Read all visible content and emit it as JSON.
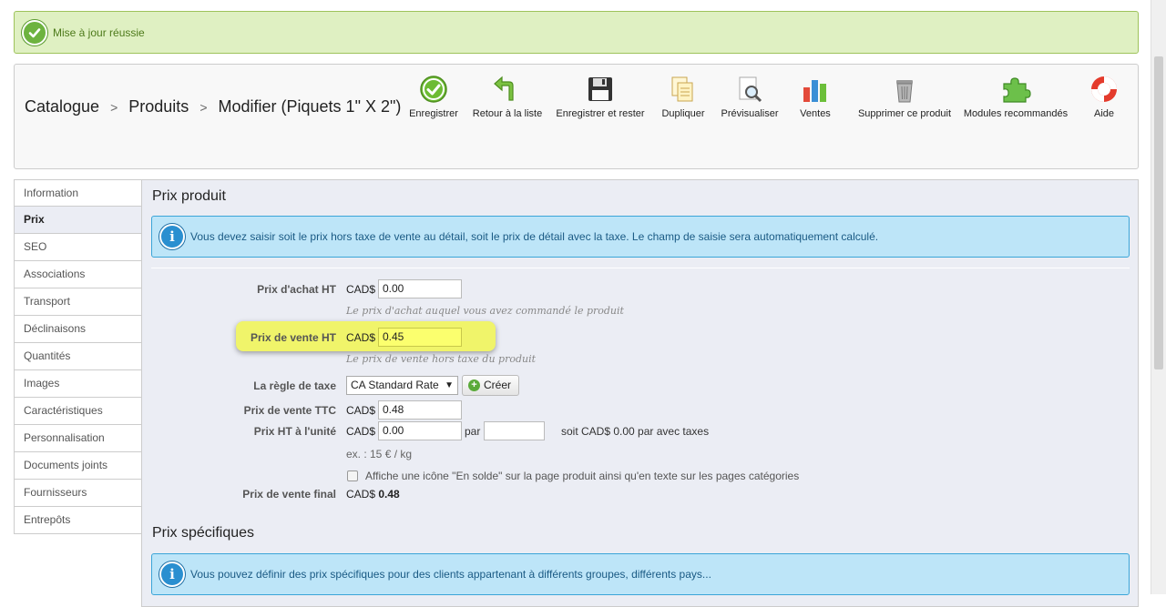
{
  "alert": {
    "message": "Mise à jour réussie"
  },
  "breadcrumb": {
    "items": [
      "Catalogue",
      "Produits",
      "Modifier (Piquets 1\" X 2\")"
    ],
    "separator": ">"
  },
  "toolbar": {
    "save": "Enregistrer",
    "back": "Retour à la liste",
    "save_stay": "Enregistrer et rester",
    "duplicate": "Dupliquer",
    "preview": "Prévisualiser",
    "sales": "Ventes",
    "delete": "Supprimer ce produit",
    "modules": "Modules recommandés",
    "help": "Aide"
  },
  "sidebar": {
    "items": [
      {
        "label": "Information"
      },
      {
        "label": "Prix"
      },
      {
        "label": "SEO"
      },
      {
        "label": "Associations"
      },
      {
        "label": "Transport"
      },
      {
        "label": "Déclinaisons"
      },
      {
        "label": "Quantités"
      },
      {
        "label": "Images"
      },
      {
        "label": "Caractéristiques"
      },
      {
        "label": "Personnalisation"
      },
      {
        "label": "Documents joints"
      },
      {
        "label": "Fournisseurs"
      },
      {
        "label": "Entrepôts"
      }
    ],
    "active": "Prix"
  },
  "main": {
    "title": "Prix produit",
    "info": "Vous devez saisir soit le prix hors taxe de vente au détail, soit le prix de détail avec la taxe. Le champ de saisie sera automatiquement calculé.",
    "currency": "CAD$",
    "wholesale": {
      "label": "Prix d'achat HT",
      "value": "0.00",
      "hint": "Le prix d'achat auquel vous avez commandé le produit"
    },
    "retail": {
      "label": "Prix de vente HT",
      "value": "0.45",
      "hint": "Le prix de vente hors taxe du produit"
    },
    "tax_rule": {
      "label": "La règle de taxe",
      "selected": "CA Standard Rate",
      "create": "Créer"
    },
    "retail_ttc": {
      "label": "Prix de vente TTC",
      "value": "0.48"
    },
    "unit_price": {
      "label": "Prix HT à l'unité",
      "value": "0.00",
      "per": "par",
      "per_value": "",
      "summary": "soit CAD$ 0.00 par avec taxes",
      "example": "ex. : 15 € / kg"
    },
    "on_sale": {
      "label": "Affiche une icône \"En solde\" sur la page produit ainsi qu'en texte sur les pages catégories",
      "checked": false
    },
    "final": {
      "label": "Prix de vente final",
      "value": "0.48"
    }
  },
  "specific": {
    "title": "Prix spécifiques",
    "info": "Vous pouvez définir des prix spécifiques pour des clients appartenant à différents groupes, différents pays..."
  },
  "colors": {
    "success": "#dff0c2",
    "info": "#bde5f8",
    "highlight": "#f0f46a",
    "panel": "#ebedf4"
  }
}
